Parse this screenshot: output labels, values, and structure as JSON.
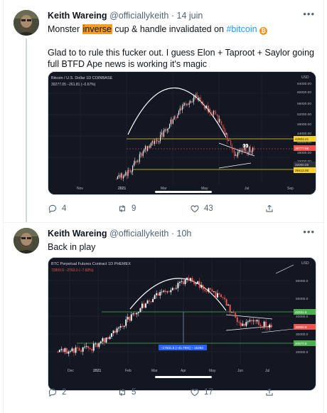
{
  "tweets": [
    {
      "author": {
        "name": "Keith Wareing",
        "handle": "@officiallykeith"
      },
      "time": "14 juin",
      "text": {
        "prefix": "Monster ",
        "highlight": "inverse",
        "middle": " cup & handle invalidated on ",
        "hashtag": "#bitcoin",
        "emoji": "₿",
        "line2": "Glad to to rule this fucker out. I guess Elon + Taproot + Saylor going full BTFD Ape news is working it's magic"
      },
      "chart": {
        "title": "Bitcoin / U.S. Dollar  1D  COINBASE",
        "ohlc": "39277.05 −261.81 (−0.67%)",
        "currency": "USD",
        "price_labels": [
          "64000.00",
          "60000.00",
          "56000.00",
          "52000.00",
          "48000.00",
          "44000.00",
          "40000.00",
          "36000.00",
          "32000.00"
        ],
        "level_labels": [
          "42502.41",
          "38777.58",
          "32000.00",
          "29412.00"
        ],
        "months": [
          "Nov",
          "2021",
          "Mar",
          "May",
          "Jul",
          "Sep"
        ]
      },
      "stats": {
        "replies": "4",
        "retweets": "9",
        "likes": "43"
      }
    },
    {
      "author": {
        "name": "Keith Wareing",
        "handle": "@officiallykeith"
      },
      "time": "10h",
      "text": {
        "line1": "Back in play"
      },
      "chart": {
        "title": "BTC Perpetual Futures Contract  1D  PHEMEX",
        "ohlc": "72800.5  −2763.0 (−7.82%)",
        "currency": "USD",
        "price_labels": [
          "60000.0",
          "50000.0",
          "40000.0",
          "30000.0",
          "20000.0"
        ],
        "level_labels": [
          "42831.5",
          "32800.5",
          "20670.5"
        ],
        "measure_label": "−17631.5 (−41.75%) − 15282",
        "months": [
          "Dec",
          "2021",
          "Feb",
          "Mar",
          "Apr",
          "May",
          "Jun",
          "Jul"
        ]
      },
      "stats": {
        "replies": "2",
        "retweets": "5",
        "likes": "17"
      }
    }
  ],
  "icons": [
    "more-icon",
    "reply-icon",
    "retweet-icon",
    "like-icon",
    "share-icon",
    "bitcoin-icon"
  ],
  "colors": {
    "accent": "#1d9bf0",
    "highlight": "#f49c24",
    "chart_bg": "#131722",
    "candle_up": "#ffffff",
    "candle_down": "#ef5350",
    "level_yellow": "#f5d327",
    "level_green": "#4caf50"
  }
}
